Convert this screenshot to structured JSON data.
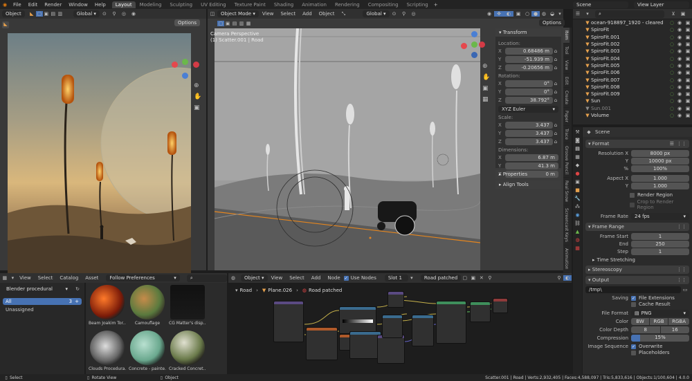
{
  "topbar": {
    "menus": [
      "File",
      "Edit",
      "Render",
      "Window",
      "Help"
    ],
    "workspaces": [
      "Layout",
      "Modeling",
      "Sculpting",
      "UV Editing",
      "Texture Paint",
      "Shading",
      "Animation",
      "Rendering",
      "Compositing",
      "Scripting"
    ],
    "active": "Layout",
    "scene": "Scene",
    "view_layer": "View Layer"
  },
  "image_editor": {
    "mode": "Object",
    "orientation": "Global",
    "options": "Options"
  },
  "viewport": {
    "mode": "Object Mode",
    "menus": [
      "View",
      "Select",
      "Add",
      "Object"
    ],
    "orientation": "Global",
    "options": "Options",
    "info_line1": "Camera Perspective",
    "info_line2": "(1) Scatter.001 | Road"
  },
  "npanel": {
    "transform": "Transform",
    "location_lbl": "Location:",
    "location": [
      {
        "axis": "X",
        "val": "0.68486 m"
      },
      {
        "axis": "Y",
        "val": "-51.939 m"
      },
      {
        "axis": "Z",
        "val": "-0.20656 m"
      }
    ],
    "rotation_lbl": "Rotation:",
    "rotation": [
      {
        "axis": "X",
        "val": "0°"
      },
      {
        "axis": "Y",
        "val": "0°"
      },
      {
        "axis": "Z",
        "val": "38.792°"
      }
    ],
    "euler": "XYZ Euler",
    "scale_lbl": "Scale:",
    "scale": [
      {
        "axis": "X",
        "val": "3.437"
      },
      {
        "axis": "Y",
        "val": "3.437"
      },
      {
        "axis": "Z",
        "val": "3.437"
      }
    ],
    "dims_lbl": "Dimensions:",
    "dims": [
      {
        "axis": "X",
        "val": "6.87 m"
      },
      {
        "axis": "Y",
        "val": "41.3 m"
      },
      {
        "axis": "Z",
        "val": "0 m"
      }
    ],
    "properties": "Properties",
    "align_tools": "Align Tools"
  },
  "side_tabs": [
    "Item",
    "Tool",
    "View",
    "Edit",
    "Create",
    "Paper",
    "Trace",
    "Groove Pencil",
    "Real Snow",
    "Screencast Keys",
    "Animation"
  ],
  "outliner": {
    "items": [
      {
        "name": "ocean-918897_1920 - cleared",
        "color": "#e5a04d"
      },
      {
        "name": "SpiroFit",
        "color": "#e5a04d"
      },
      {
        "name": "SpiroFit.001",
        "color": "#e5a04d"
      },
      {
        "name": "SpiroFit.002",
        "color": "#e5a04d"
      },
      {
        "name": "SpiroFit.003",
        "color": "#e5a04d"
      },
      {
        "name": "SpiroFit.004",
        "color": "#e5a04d"
      },
      {
        "name": "SpiroFit.005",
        "color": "#e5a04d"
      },
      {
        "name": "SpiroFit.006",
        "color": "#e5a04d"
      },
      {
        "name": "SpiroFit.007",
        "color": "#e5a04d"
      },
      {
        "name": "SpiroFit.008",
        "color": "#e5a04d"
      },
      {
        "name": "SpiroFit.009",
        "color": "#e5a04d"
      },
      {
        "name": "Sun",
        "color": "#e5a04d"
      },
      {
        "name": "Sun.001",
        "color": "#8a8a8a"
      },
      {
        "name": "Volume",
        "color": "#e5a04d"
      }
    ]
  },
  "props": {
    "scene_name": "Scene",
    "format": "Format",
    "res_x_lbl": "Resolution X",
    "res_x": "8000 px",
    "res_y_lbl": "Y",
    "res_y": "10000 px",
    "pct_lbl": "%",
    "pct": "100%",
    "aspect_x_lbl": "Aspect X",
    "aspect_x": "1.000",
    "aspect_y_lbl": "Y",
    "aspect_y": "1.000",
    "render_region": "Render Region",
    "crop": "Crop to Render Region",
    "frame_rate_lbl": "Frame Rate",
    "frame_rate": "24 fps",
    "frame_range": "Frame Range",
    "frame_start_lbl": "Frame Start",
    "frame_start": "1",
    "end_lbl": "End",
    "end": "250",
    "step_lbl": "Step",
    "step": "1",
    "time_stretching": "Time Stretching",
    "stereoscopy": "Stereoscopy",
    "output": "Output",
    "path": "/tmp\\",
    "saving_lbl": "Saving",
    "file_ext": "File Extensions",
    "cache_result": "Cache Result",
    "file_format_lbl": "File Format",
    "file_format": "PNG",
    "color_lbl": "Color",
    "color_opts": [
      "BW",
      "RGB",
      "RGBA"
    ],
    "color_active": "RGBA",
    "depth_lbl": "Color Depth",
    "depths": [
      "8",
      "16"
    ],
    "compression_lbl": "Compression",
    "compression": "15%",
    "compression_frac": 0.15,
    "img_seq_lbl": "Image Sequence",
    "overwrite": "Overwrite",
    "placeholders": "Placeholders"
  },
  "asset_browser": {
    "menus": [
      "View",
      "Select",
      "Catalog",
      "Asset"
    ],
    "library": "Follow Preferences",
    "catalog": "Blender procedural",
    "all": "All",
    "all_count": "3",
    "unassigned": "Unassigned",
    "assets": [
      {
        "name": "Beam Joakim Tor..."
      },
      {
        "name": "Camouflage"
      },
      {
        "name": "CG Matter's disp..."
      },
      {
        "name": "Clouds Procedura..."
      },
      {
        "name": "Concrete - painte..."
      },
      {
        "name": "Cracked Concret..."
      }
    ]
  },
  "node_editor": {
    "mode": "Object",
    "menus": [
      "View",
      "Select",
      "Add",
      "Node"
    ],
    "use_nodes": "Use Nodes",
    "slot": "Slot 1",
    "material": "Road patched",
    "breadcrumb": [
      "Road",
      "Plane.026",
      "Road patched"
    ]
  },
  "status": {
    "select": "Select",
    "rotate": "Rotate View",
    "object": "Object",
    "stats": "Scatter.001 | Road | Verts:2,932,405 | Faces:4,588,097 | Tris:5,833,616 | Objects:1/100,604 | 4.0.0"
  }
}
